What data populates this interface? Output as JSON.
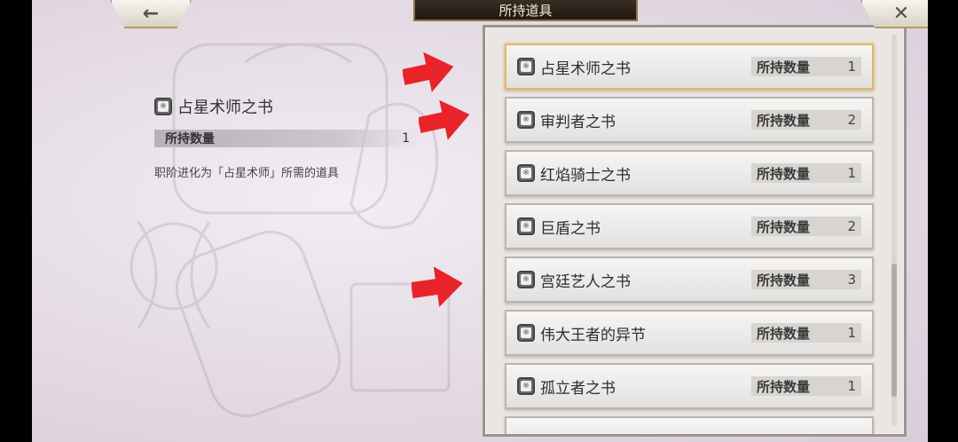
{
  "header": {
    "title": "所持道具",
    "back_icon": "←",
    "close_icon": "✕"
  },
  "detail": {
    "name": "占星术师之书",
    "qty_label": "所持数量",
    "qty_value": "1",
    "description": "职阶进化为「占星术师」所需的道具"
  },
  "items": [
    {
      "name": "占星术师之书",
      "qty_label": "所持数量",
      "qty": "1"
    },
    {
      "name": "审判者之书",
      "qty_label": "所持数量",
      "qty": "2"
    },
    {
      "name": "红焰骑士之书",
      "qty_label": "所持数量",
      "qty": "1"
    },
    {
      "name": "巨盾之书",
      "qty_label": "所持数量",
      "qty": "2"
    },
    {
      "name": "宫廷艺人之书",
      "qty_label": "所持数量",
      "qty": "3"
    },
    {
      "name": "伟大王者的异节",
      "qty_label": "所持数量",
      "qty": "1"
    },
    {
      "name": "孤立者之书",
      "qty_label": "所持数量",
      "qty": "1"
    }
  ],
  "colors": {
    "arrow": "#e8232a",
    "selected_border": "#e0b86a"
  }
}
